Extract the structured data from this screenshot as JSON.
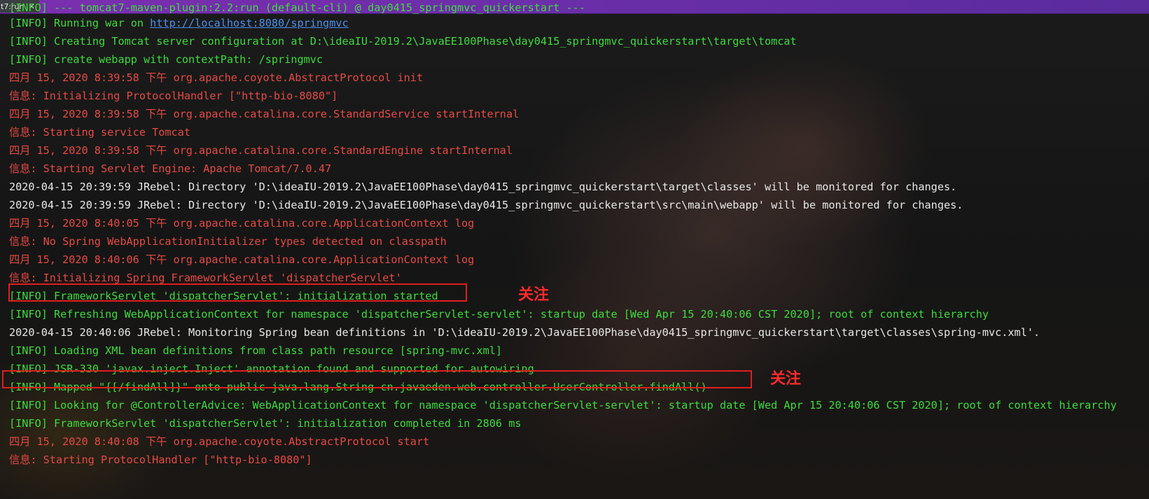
{
  "tab": {
    "label": "t7:run"
  },
  "console": {
    "lines": [
      {
        "type": "info",
        "text": "[INFO] --- tomcat7-maven-plugin:2.2:run (default-cli) @ day0415_springmvc_quickerstart ---"
      },
      {
        "type": "info",
        "prefix": "[INFO] Running war on ",
        "link": "http://localhost:8080/springmvc"
      },
      {
        "type": "info",
        "text": "[INFO] Creating Tomcat server configuration at D:\\ideaIU-2019.2\\JavaEE100Phase\\day0415_springmvc_quickerstart\\target\\tomcat"
      },
      {
        "type": "info",
        "text": "[INFO] create webapp with contextPath: /springmvc"
      },
      {
        "type": "err",
        "text": "四月 15, 2020 8:39:58 下午 org.apache.coyote.AbstractProtocol init"
      },
      {
        "type": "err",
        "text": "信息: Initializing ProtocolHandler [\"http-bio-8080\"]"
      },
      {
        "type": "err",
        "text": "四月 15, 2020 8:39:58 下午 org.apache.catalina.core.StandardService startInternal"
      },
      {
        "type": "err",
        "text": "信息: Starting service Tomcat"
      },
      {
        "type": "err",
        "text": "四月 15, 2020 8:39:58 下午 org.apache.catalina.core.StandardEngine startInternal"
      },
      {
        "type": "err",
        "text": "信息: Starting Servlet Engine: Apache Tomcat/7.0.47"
      },
      {
        "type": "plain",
        "text": "2020-04-15 20:39:59 JRebel: Directory 'D:\\ideaIU-2019.2\\JavaEE100Phase\\day0415_springmvc_quickerstart\\target\\classes' will be monitored for changes."
      },
      {
        "type": "plain",
        "text": "2020-04-15 20:39:59 JRebel: Directory 'D:\\ideaIU-2019.2\\JavaEE100Phase\\day0415_springmvc_quickerstart\\src\\main\\webapp' will be monitored for changes."
      },
      {
        "type": "err",
        "text": "四月 15, 2020 8:40:05 下午 org.apache.catalina.core.ApplicationContext log"
      },
      {
        "type": "err",
        "text": "信息: No Spring WebApplicationInitializer types detected on classpath"
      },
      {
        "type": "err",
        "text": "四月 15, 2020 8:40:06 下午 org.apache.catalina.core.ApplicationContext log"
      },
      {
        "type": "err",
        "text": "信息: Initializing Spring FrameworkServlet 'dispatcherServlet'"
      },
      {
        "type": "info",
        "text": "[INFO] FrameworkServlet 'dispatcherServlet': initialization started"
      },
      {
        "type": "info",
        "text": "[INFO] Refreshing WebApplicationContext for namespace 'dispatcherServlet-servlet': startup date [Wed Apr 15 20:40:06 CST 2020]; root of context hierarchy"
      },
      {
        "type": "plain",
        "text": "2020-04-15 20:40:06 JRebel: Monitoring Spring bean definitions in 'D:\\ideaIU-2019.2\\JavaEE100Phase\\day0415_springmvc_quickerstart\\target\\classes\\spring-mvc.xml'."
      },
      {
        "type": "info",
        "text": "[INFO] Loading XML bean definitions from class path resource [spring-mvc.xml]"
      },
      {
        "type": "info",
        "text": "[INFO] JSR-330 'javax.inject.Inject' annotation found and supported for autowiring"
      },
      {
        "type": "info",
        "text": "[INFO] Mapped \"{[/findAll]}\" onto public java.lang.String cn.javaeden.web.controller.UserController.findAll()"
      },
      {
        "type": "info",
        "text": "[INFO] Looking for @ControllerAdvice: WebApplicationContext for namespace 'dispatcherServlet-servlet': startup date [Wed Apr 15 20:40:06 CST 2020]; root of context hierarchy"
      },
      {
        "type": "info",
        "text": "[INFO] FrameworkServlet 'dispatcherServlet': initialization completed in 2806 ms"
      },
      {
        "type": "err",
        "text": "四月 15, 2020 8:40:08 下午 org.apache.coyote.AbstractProtocol start"
      },
      {
        "type": "err",
        "text": "信息: Starting ProtocolHandler [\"http-bio-8080\"]"
      }
    ]
  },
  "annotations": [
    {
      "text": "关注"
    },
    {
      "text": "关注"
    }
  ]
}
